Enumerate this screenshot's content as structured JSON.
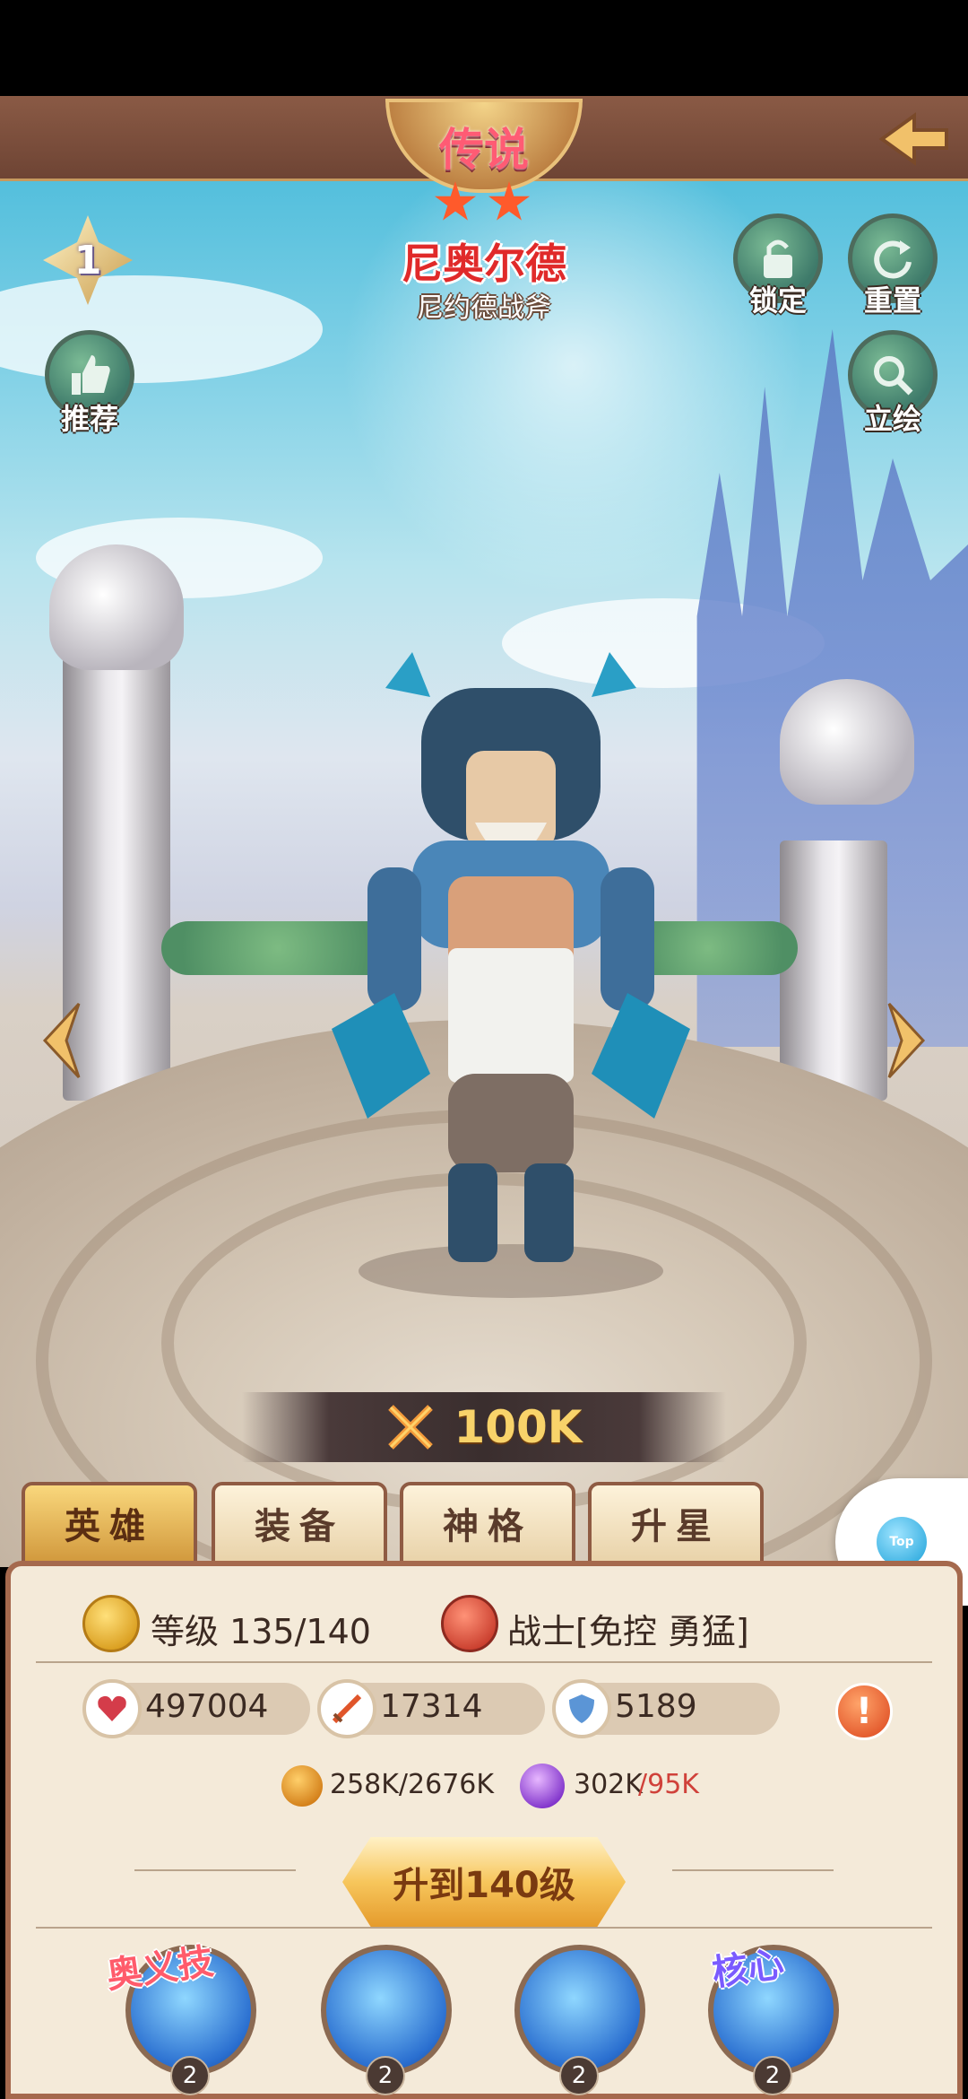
{
  "header": {
    "rarity": "传说",
    "star_count": 2,
    "hero_name": "尼奥尔德",
    "hero_subtitle": "尼约德战斧"
  },
  "left_controls": {
    "level_badge": "1",
    "recommend_label": "推荐"
  },
  "right_controls": {
    "lock_label": "锁定",
    "reset_label": "重置",
    "portrait_label": "立绘"
  },
  "power": {
    "value": "100K",
    "icon": "crossed-swords-icon"
  },
  "tabs": [
    {
      "label": "英雄",
      "active": true
    },
    {
      "label": "装备",
      "active": false
    },
    {
      "label": "神格",
      "active": false
    },
    {
      "label": "升星",
      "active": false
    }
  ],
  "panel": {
    "level_text": "等级 135/140",
    "class_text": "战士[免控 勇猛]",
    "stats": [
      {
        "icon": "heart-icon",
        "value": "497004"
      },
      {
        "icon": "sword-icon",
        "value": "17314"
      },
      {
        "icon": "shield-icon",
        "value": "5189"
      }
    ],
    "resources": {
      "gold": "258K/2676K",
      "exp_have": "302K",
      "exp_need": "/95K"
    },
    "upgrade_label": "升到140级",
    "skills": [
      {
        "level": "2",
        "tag": "奥义技"
      },
      {
        "level": "2",
        "tag": ""
      },
      {
        "level": "2",
        "tag": ""
      },
      {
        "level": "2",
        "tag": "核心"
      }
    ]
  },
  "floating": {
    "top_label": "Top"
  },
  "colors": {
    "accent_gold": "#f7c65c",
    "rarity_pink": "#ff5b74",
    "name_red": "#e02a2a",
    "panel_bg": "#f4ead9",
    "panel_border": "#a5694d"
  }
}
